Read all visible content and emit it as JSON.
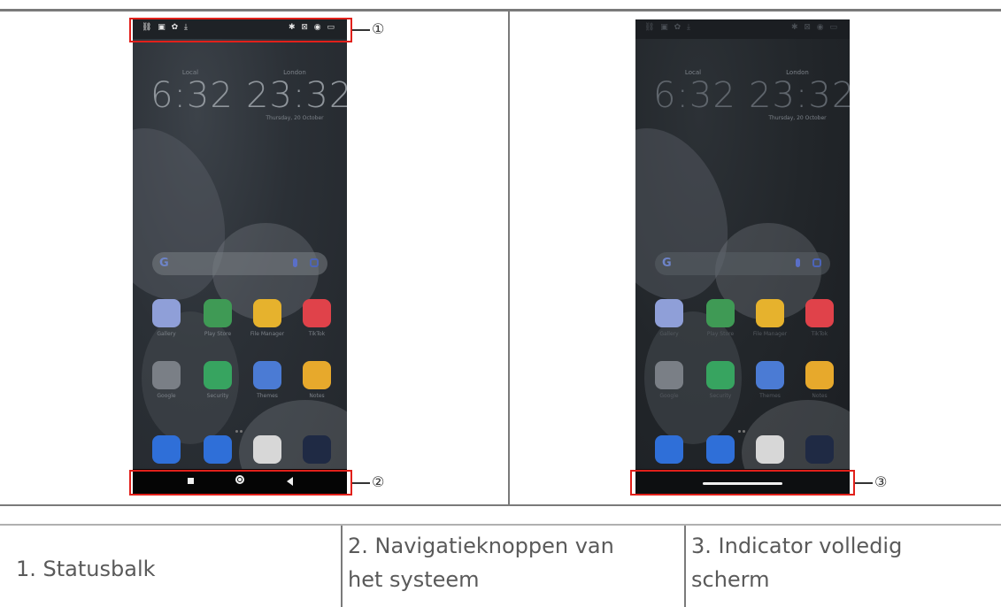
{
  "phone_left": {
    "status_icons_left": "⛓ ▣ ✿ ⤓",
    "status_icons_right": "✱ ⊠ ◉ ▭",
    "clock_left": {
      "label": "Local",
      "time": "6:32"
    },
    "clock_right": {
      "label": "London",
      "time": "23:32",
      "date": "Thursday, 20 October"
    },
    "apps_row1": [
      "Gallery",
      "Play Store",
      "File Manager",
      "TikTok"
    ],
    "apps_row2": [
      "Google",
      "Security",
      "Themes",
      "Notes"
    ],
    "nav_type": "buttons"
  },
  "phone_right": {
    "status_icons_left": "⛓ ▣ ✿ ⤓",
    "status_icons_right": "✱ ⊠ ◉ ▭",
    "clock_left": {
      "label": "Local",
      "time": "6:32"
    },
    "clock_right": {
      "label": "London",
      "time": "23:32",
      "date": "Thursday, 20 October"
    },
    "apps_row1": [
      "Gallery",
      "Play Store",
      "File Manager",
      "TikTok"
    ],
    "apps_row2": [
      "Google",
      "Security",
      "Themes",
      "Notes"
    ],
    "nav_type": "gesture"
  },
  "callouts": {
    "one": "①",
    "two": "②",
    "three": "③"
  },
  "captions": {
    "cell1": "1. Statusbalk",
    "cell2_line1": "2. Navigatieknoppen van",
    "cell2_line2": "het systeem",
    "cell3_line1": "3. Indicator volledig",
    "cell3_line2": "scherm"
  },
  "colors": {
    "callout_red": "#e1201a",
    "app_icons": [
      "#8f9fd8",
      "#3f9a55",
      "#e6b22d",
      "#e0424a",
      "#7a7f86",
      "#37a460",
      "#4b7bd4",
      "#e7a92c",
      "#2f6fd8",
      "#2f6fd8",
      "#d7d7d7",
      "#1f2a44"
    ]
  }
}
